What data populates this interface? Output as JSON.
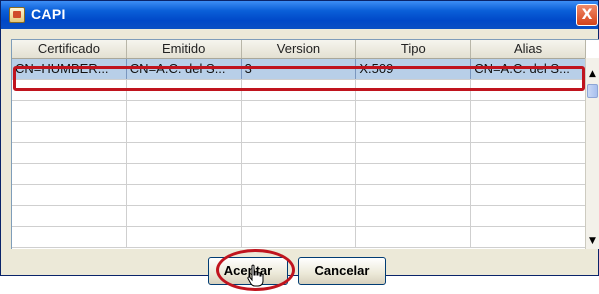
{
  "window": {
    "title": "CAPI",
    "close_label": "X"
  },
  "table": {
    "columns": [
      "Certificado",
      "Emitido",
      "Version",
      "Tipo",
      "Alias"
    ],
    "rows": [
      [
        "CN=HUMBER...",
        "CN=A.C. del S...",
        "3",
        "X.509",
        "CN=A.C. del S..."
      ]
    ],
    "empty_rows": 8,
    "selected_row": 0
  },
  "buttons": {
    "accept": "Aceptar",
    "cancel": "Cancelar"
  },
  "colors": {
    "title_bar": "#0048C8",
    "selection": "#B8CFE8",
    "annotation": "#C0141E"
  },
  "icons": {
    "app": "capi-app-icon",
    "cursor": "hand-pointer-icon"
  }
}
